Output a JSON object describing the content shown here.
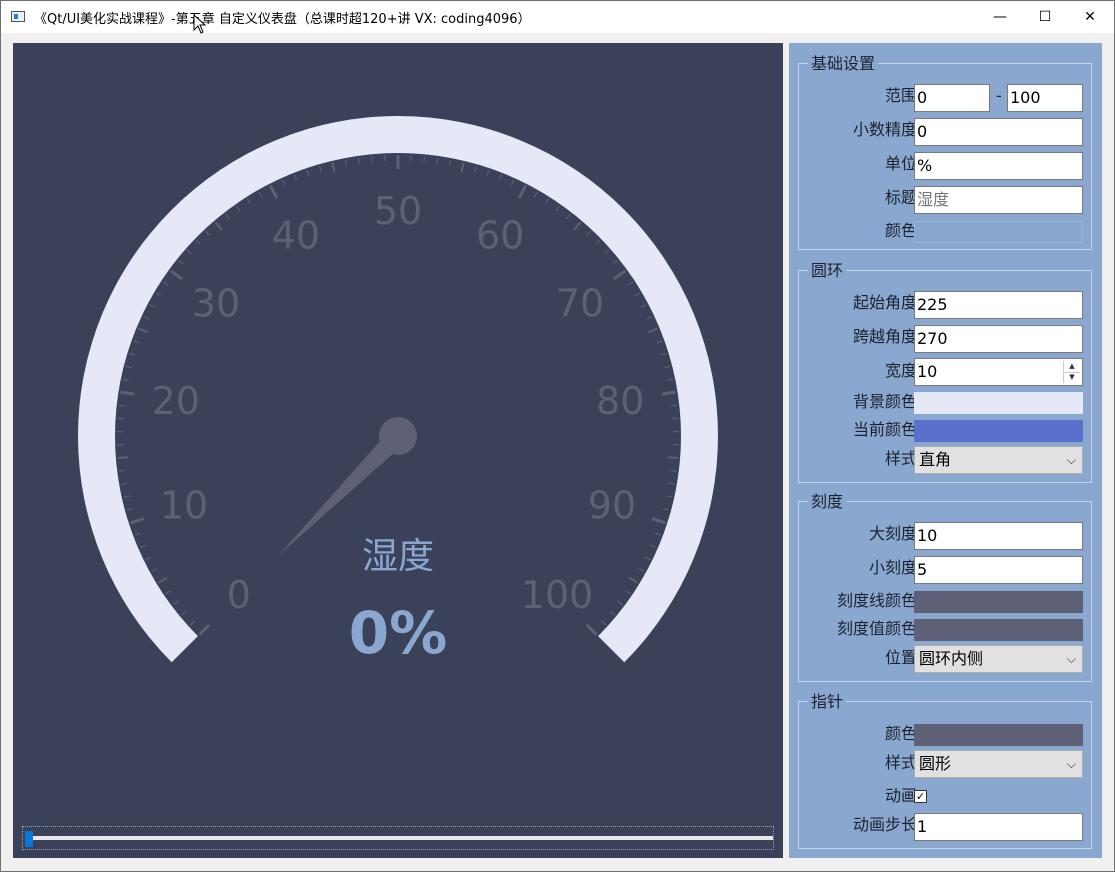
{
  "window": {
    "title": "《Qt/UI美化实战课程》-第五章 自定义仪表盘（总课时超120+讲 VX: coding4096）",
    "minimize_glyph": "—",
    "maximize_glyph": "☐",
    "close_glyph": "✕"
  },
  "gauge": {
    "value": 0,
    "min": 0,
    "max": 100,
    "start_angle": 225,
    "span_angle": 270,
    "title": "湿度",
    "value_text": "0%",
    "scale_labels": [
      "0",
      "10",
      "20",
      "30",
      "40",
      "50",
      "60",
      "70",
      "80",
      "90",
      "100"
    ],
    "colors": {
      "background": "#3a4159",
      "ring": "#e4e8f7",
      "ticks": "#5d6077",
      "pointer": "#5d6077",
      "title": "#8aa7cf",
      "value": "#8aa7cf"
    }
  },
  "slider": {
    "value_fraction": 0.0
  },
  "panel": {
    "basic": {
      "title": "基础设置",
      "range_label": "范围",
      "range_min": "0",
      "range_sep": "-",
      "range_max": "100",
      "precision_label": "小数精度",
      "precision_value": "0",
      "unit_label": "单位",
      "unit_value": "%",
      "title_label": "标题",
      "title_value": "湿度",
      "color_label": "颜色",
      "color_value": "#8aa7cf"
    },
    "ring": {
      "title": "圆环",
      "start_label": "起始角度",
      "start_value": "225",
      "span_label": "跨越角度",
      "span_value": "270",
      "width_label": "宽度",
      "width_value": "10",
      "bg_color_label": "背景颜色",
      "bg_color": "#e4e8f7",
      "cur_color_label": "当前颜色",
      "cur_color": "#5a70cc",
      "style_label": "样式",
      "style_value": "直角"
    },
    "scale": {
      "title": "刻度",
      "major_label": "大刻度",
      "major_value": "10",
      "minor_label": "小刻度",
      "minor_value": "5",
      "line_color_label": "刻度线颜色",
      "line_color": "#5d6077",
      "value_color_label": "刻度值颜色",
      "value_color": "#5d6077",
      "position_label": "位置",
      "position_value": "圆环内侧"
    },
    "pointer": {
      "title": "指针",
      "color_label": "颜色",
      "color": "#5d6077",
      "style_label": "样式",
      "style_value": "圆形",
      "anim_label": "动画",
      "anim_checked": "✓",
      "anim_step_label": "动画步长",
      "anim_step_value": "1"
    }
  }
}
